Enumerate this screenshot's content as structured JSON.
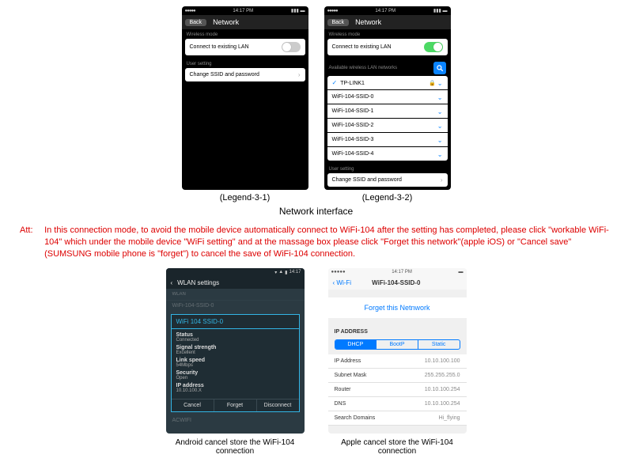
{
  "legend31": {
    "time": "14:17 PM",
    "back": "Back",
    "title": "Network",
    "wirelessMode": "Wireless mode",
    "connectLan": "Connect to existing LAN",
    "userSetting": "User setting",
    "changeSsid": "Change SSID and password",
    "caption": "(Legend-3-1)"
  },
  "legend32": {
    "time": "14:17 PM",
    "back": "Back",
    "title": "Network",
    "wirelessMode": "Wireless mode",
    "connectLan": "Connect to existing LAN",
    "availableNetworks": "Available wireless LAN networks",
    "networks": [
      {
        "name": "TP-LINK1",
        "locked": true,
        "checked": true
      },
      {
        "name": "WiFi-104-SSID-0",
        "locked": false,
        "checked": false
      },
      {
        "name": "WiFi-104-SSID-1",
        "locked": false,
        "checked": false
      },
      {
        "name": "WiFi-104-SSID-2",
        "locked": false,
        "checked": false
      },
      {
        "name": "WiFi-104-SSID-3",
        "locked": false,
        "checked": false
      },
      {
        "name": "WiFi-104-SSID-4",
        "locked": false,
        "checked": false
      }
    ],
    "userSetting": "User setting",
    "changeSsid": "Change SSID and password",
    "caption": "(Legend-3-2)"
  },
  "centerCaption": "Network interface",
  "att": {
    "label": "Att:",
    "text": "In this connection mode, to avoid the mobile device automatically connect to WiFi-104 after the setting has completed, please click \"workable WiFi-104\" which under the mobile device \"WiFi setting\" and at the massage box please click \"Forget this network\"(apple iOS) or \"Cancel save\" (SUMSUNG mobile phone is \"forget\") to cancel the save of WiFi-104 connection."
  },
  "android": {
    "header": "WLAN settings",
    "sectWlan": "WLAN",
    "dimSsid": "WiFi-104-SSID-0",
    "modalTitle": "WiFi 104 SSID-0",
    "fields": [
      {
        "k": "Status",
        "v": "Connected"
      },
      {
        "k": "Signal strength",
        "v": "Excellent"
      },
      {
        "k": "Link speed",
        "v": "54Mbps"
      },
      {
        "k": "Security",
        "v": "Open"
      },
      {
        "k": "IP address",
        "v": "10.10.100.X"
      }
    ],
    "btnCancel": "Cancel",
    "btnForget": "Forget",
    "btnDisconnect": "Disconnect",
    "dimAcwifi": "ACWIFI",
    "caption": "Android cancel store the WiFi-104 connection"
  },
  "ios": {
    "time": "14:17 PM",
    "back": "Wi-Fi",
    "title": "WiFi-104-SSID-0",
    "forget": "Forget this Netnwork",
    "sectIp": "IP ADDRESS",
    "segDhcp": "DHCP",
    "segBootp": "BootP",
    "segStatic": "Static",
    "rows": [
      {
        "k": "IP Address",
        "v": "10.10.100.100"
      },
      {
        "k": "Subnet Mask",
        "v": "255.255.255.0"
      },
      {
        "k": "Router",
        "v": "10.10.100.254"
      },
      {
        "k": "DNS",
        "v": "10.10.100.254"
      },
      {
        "k": "Search Domains",
        "v": "Hi_flying"
      }
    ],
    "caption": "Apple cancel store the WiFi-104 connection"
  }
}
